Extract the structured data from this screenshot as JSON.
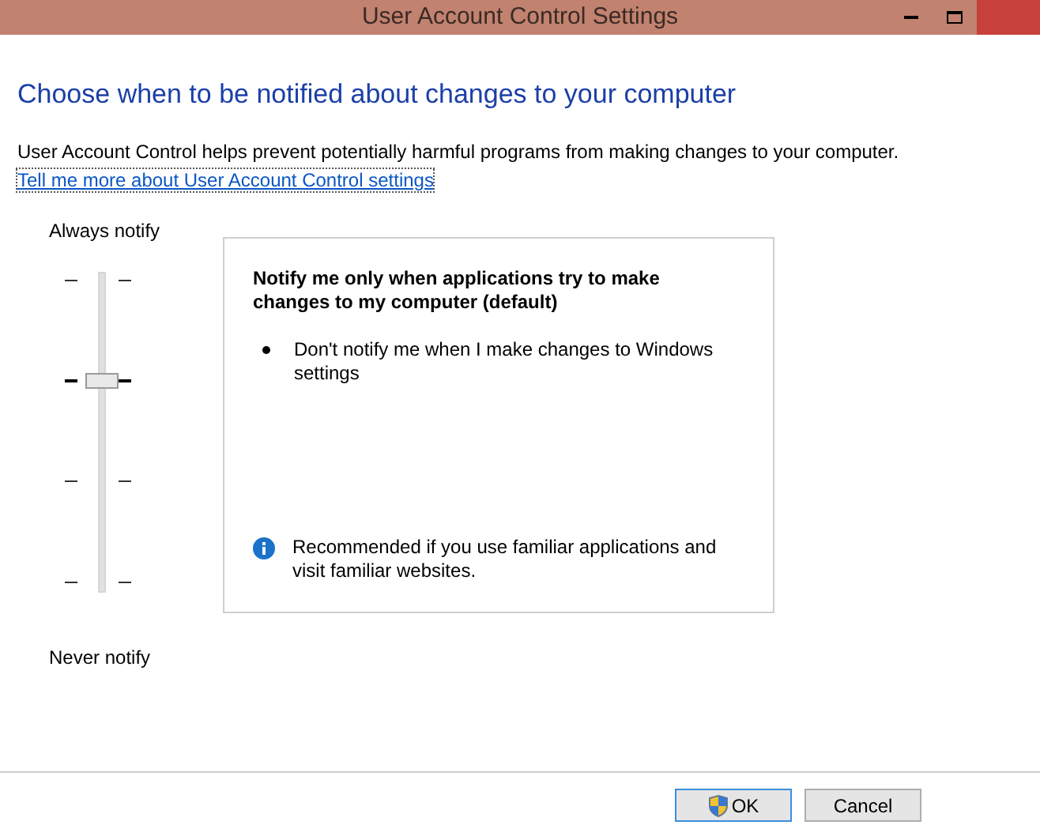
{
  "window": {
    "title": "User Account Control Settings"
  },
  "heading": "Choose when to be notified about changes to your computer",
  "description": "User Account Control helps prevent potentially harmful programs from making changes to your computer.",
  "link": "Tell me more about User Account Control settings",
  "slider": {
    "top_label": "Always notify",
    "bottom_label": "Never notify",
    "level": 0.667
  },
  "panel": {
    "title": "Notify me only when applications try to make changes to my computer (default)",
    "bullets": [
      "Don't notify me when I make changes to Windows settings"
    ],
    "info": "Recommended if you use familiar applications and visit familiar websites."
  },
  "buttons": [
    {
      "label": "OK",
      "kind": "shield"
    },
    {
      "label": "Cancel",
      "kind": "plain"
    }
  ]
}
